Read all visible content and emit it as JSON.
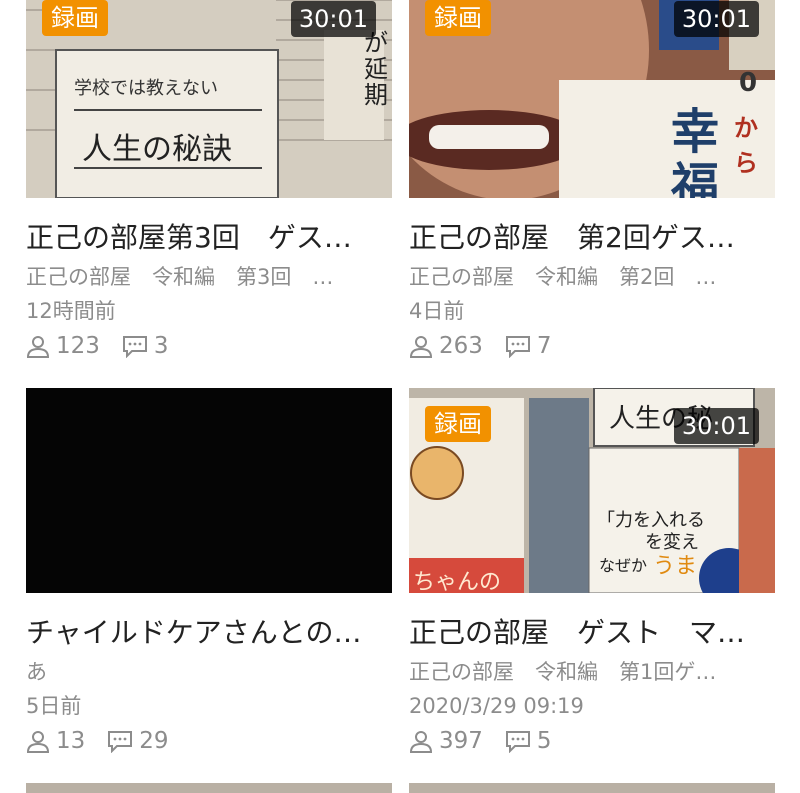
{
  "colors": {
    "badge": "#f29100",
    "meta": "#8c8c8c"
  },
  "cards": [
    {
      "badge": "録画",
      "duration": "30:01",
      "thumb_texts": [
        "学校では教えない",
        "人生の秘訣",
        "が延期"
      ],
      "title": "正己の部屋第3回　ゲス…",
      "subtitle": "正己の部屋　令和編　第3回　…",
      "time": "12時間前",
      "viewers": "123",
      "comments": "3"
    },
    {
      "badge": "録画",
      "duration": "30:01",
      "thumb_texts": [
        "0",
        "から",
        "幸",
        "福"
      ],
      "title": "正己の部屋　第2回ゲス…",
      "subtitle": "正己の部屋　令和編　第2回　…",
      "time": "4日前",
      "viewers": "263",
      "comments": "7"
    },
    {
      "badge": "",
      "duration": "",
      "thumb_texts": [],
      "title": "チャイルドケアさんとの…",
      "subtitle": "あ",
      "time": "5日前",
      "viewers": "13",
      "comments": "29"
    },
    {
      "badge": "録画",
      "duration": "30:01",
      "thumb_texts": [
        "人生の秘",
        "「力を入れる",
        "を変え",
        "なぜか",
        "うま",
        "ちゃんの"
      ],
      "title": "正己の部屋　ゲスト　マ…",
      "subtitle": "正己の部屋　令和編　第1回ゲ…",
      "time": "2020/3/29 09:19",
      "viewers": "397",
      "comments": "5"
    }
  ],
  "icons": {
    "viewers": "person-icon",
    "comments": "comment-icon"
  }
}
